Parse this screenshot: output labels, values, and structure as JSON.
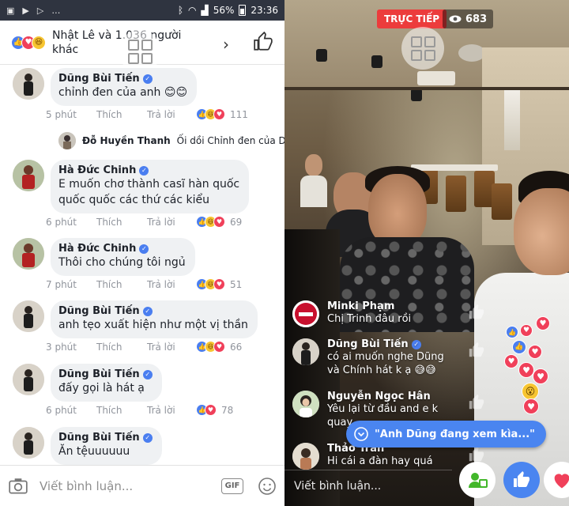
{
  "status_bar": {
    "battery": "56%",
    "time": "23:36",
    "left_icons": [
      "image-icon",
      "play-store-icon",
      "play-icon",
      "more-icon"
    ]
  },
  "left": {
    "reactions_summary": "Nhật Lê và 1.036 người khác",
    "comments": [
      {
        "name": "Dũng Bùi Tiến",
        "text": "chỉnh đen của anh 😊😊",
        "time": "5 phút",
        "like": "Thích",
        "reply": "Trả lời",
        "count": "111",
        "reactions": [
          "like",
          "haha",
          "love"
        ]
      },
      {
        "name": "Hà Đức Chinh",
        "text_lines": [
          "E muốn chơ thành casĩ hàn quốc",
          "quốc quốc các thứ các kiểu"
        ],
        "time": "6 phút",
        "like": "Thích",
        "reply": "Trả lời",
        "count": "69",
        "reactions": [
          "like",
          "haha",
          "love"
        ]
      },
      {
        "name": "Hà Đức Chinh",
        "text": "Thôi cho chúng tôi ngủ",
        "time": "7 phút",
        "like": "Thích",
        "reply": "Trả lời",
        "count": "51",
        "reactions": [
          "like",
          "haha",
          "love"
        ]
      },
      {
        "name": "Dũng Bùi Tiến",
        "text": "anh tẹo xuất hiện như một vị thần",
        "time": "3 phút",
        "like": "Thích",
        "reply": "Trả lời",
        "count": "66",
        "reactions": [
          "like",
          "haha",
          "love"
        ]
      },
      {
        "name": "Dũng Bùi Tiến",
        "text": "đấy gọi là hát ạ",
        "time": "6 phút",
        "like": "Thích",
        "reply": "Trả lời",
        "count": "78",
        "reactions": [
          "like",
          "love"
        ]
      },
      {
        "name": "Dũng Bùi Tiến",
        "text": "Ăn tệuuuuuu"
      }
    ],
    "reply_preview": {
      "name": "Đỗ Huyền Thanh",
      "text": "Ối dồi Chỉnh đen của D..."
    },
    "composer_placeholder": "Viết bình luận...",
    "gif_label": "GIF"
  },
  "right": {
    "live_label": "TRỰC TIẾP",
    "viewers": "683",
    "comments": [
      {
        "name": "Minki Phạm",
        "text": "Chị Trinh đâu rồi",
        "verified": false
      },
      {
        "name": "Dũng Bùi Tiến",
        "text": "có ai muốn nghe Dũng và Chính hát k ạ 😅😅",
        "verified": true
      },
      {
        "name": "Nguyễn Ngọc Hân",
        "text": "Yêu lại từ đầu and e k quay...",
        "verified": false
      },
      {
        "name": "Thảo Trần",
        "text": "Hi cái a đàn hay quá",
        "verified": false
      }
    ],
    "toast": "\"Anh Dũng đang xem kìa...\"",
    "composer_placeholder": "Viết bình luận..."
  },
  "colors": {
    "facebook_blue": "#4a7ef0",
    "live_red": "#ec3c3c",
    "love_red": "#f0405a",
    "haha_yellow": "#f7c531"
  }
}
